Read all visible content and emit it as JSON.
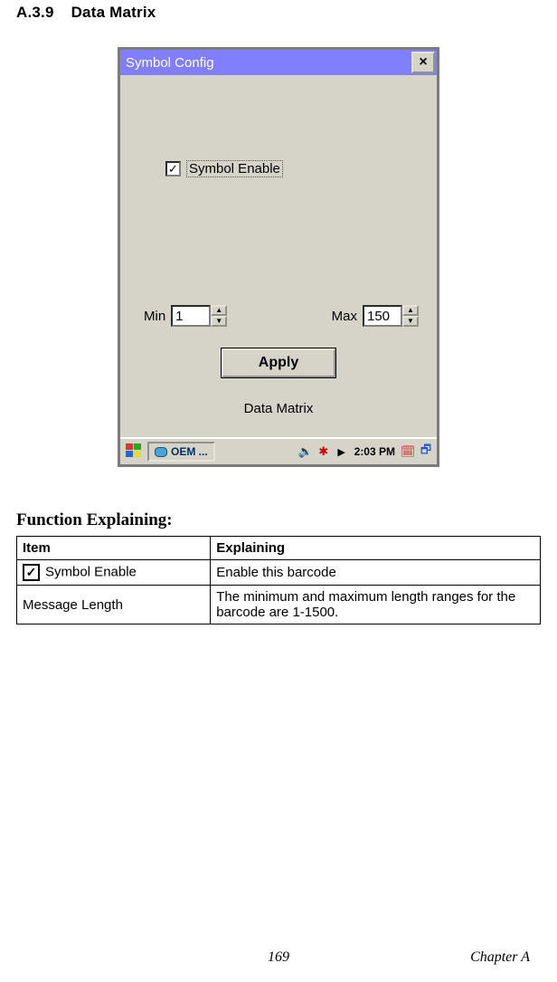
{
  "heading": {
    "number": "A.3.9",
    "title": "Data Matrix"
  },
  "dialog": {
    "title": "Symbol Config",
    "close": "×",
    "enable_label": "Symbol Enable",
    "min_label": "Min",
    "min_value": "1",
    "max_label": "Max",
    "max_value": "150",
    "apply": "Apply",
    "subtitle": "Data Matrix"
  },
  "taskbar": {
    "task_label": "OEM ...",
    "clock": "2:03 PM"
  },
  "section2_title": "Function Explaining:",
  "table": {
    "head": {
      "item": "Item",
      "explaining": "Explaining"
    },
    "rows": [
      {
        "item": "Symbol Enable",
        "explaining": "Enable this barcode"
      },
      {
        "item": "Message Length",
        "explaining": "The minimum and maximum length ranges for the barcode are 1-1500."
      }
    ]
  },
  "footer": {
    "page": "169",
    "chapter": "Chapter A"
  }
}
